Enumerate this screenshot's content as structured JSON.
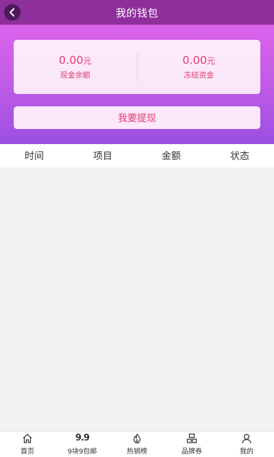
{
  "header": {
    "title": "我的钱包",
    "back_icon": "chevron-left-icon"
  },
  "balance": {
    "cash": {
      "value": "0.00",
      "unit": "元",
      "label": "现金余额"
    },
    "frozen": {
      "value": "0.00",
      "unit": "元",
      "label": "冻结资金"
    }
  },
  "withdraw": {
    "label": "我要提现"
  },
  "table": {
    "columns": [
      "时间",
      "项目",
      "金额",
      "状态"
    ],
    "rows": []
  },
  "bottom_nav": {
    "items": [
      {
        "label": "首页",
        "icon": "home-icon"
      },
      {
        "label": "9块9包邮",
        "icon": "nine-nine-icon",
        "glyph": "9.9"
      },
      {
        "label": "热销榜",
        "icon": "flame-icon"
      },
      {
        "label": "品牌券",
        "icon": "brand-icon"
      },
      {
        "label": "我的",
        "icon": "user-icon"
      }
    ]
  },
  "colors": {
    "topbar": "#8e2f9c",
    "hero_gradient_top": "#e567f0",
    "hero_gradient_bottom": "#9b4fe3",
    "accent_text": "#e03f6e"
  }
}
